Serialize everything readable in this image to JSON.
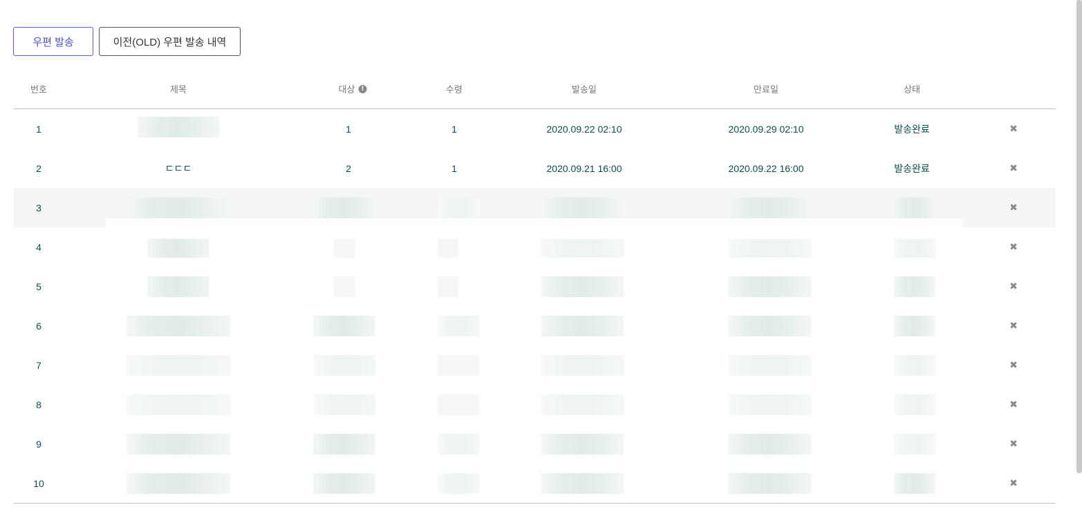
{
  "toolbar": {
    "send_mail_label": "우편 발송",
    "old_history_label": "이전(OLD) 우편 발송 내역"
  },
  "table": {
    "headers": {
      "no": "번호",
      "title": "제목",
      "target": "대상",
      "received": "수령",
      "sent_date": "발송일",
      "expire_date": "만료일",
      "status": "상태"
    },
    "rows": [
      {
        "no": "1",
        "title": "",
        "target": "1",
        "received": "1",
        "sent_date": "2020.09.22 02:10",
        "expire_date": "2020.09.29 02:10",
        "status": "발송완료",
        "delete": "✖"
      },
      {
        "no": "2",
        "title": "ㄷㄷㄷ",
        "target": "2",
        "received": "1",
        "sent_date": "2020.09.21 16:00",
        "expire_date": "2020.09.22 16:00",
        "status": "발송완료",
        "delete": "✖"
      },
      {
        "no": "3",
        "delete": "✖"
      },
      {
        "no": "4",
        "delete": "✖"
      },
      {
        "no": "5",
        "delete": "✖"
      },
      {
        "no": "6",
        "delete": "✖"
      },
      {
        "no": "7",
        "delete": "✖"
      },
      {
        "no": "8",
        "delete": "✖"
      },
      {
        "no": "9",
        "delete": "✖"
      },
      {
        "no": "10",
        "delete": "✖"
      }
    ]
  },
  "colors": {
    "primary_button_border": "#5b5bd6",
    "row_text": "#0e4d4d",
    "highlight_row": "#f5f5f5"
  }
}
